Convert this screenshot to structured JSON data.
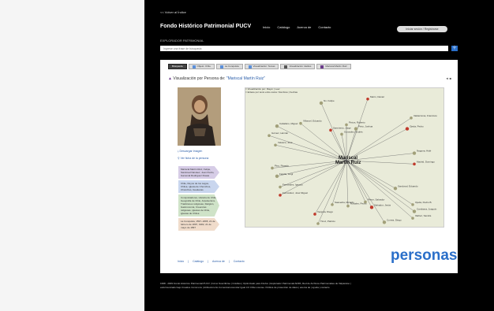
{
  "header": {
    "back_link": "<< Volver al Índice",
    "site_title": "Fondo Histórico Patrimonial PUCV",
    "nav": [
      "Inicio",
      "Catálogo",
      "Acerca de",
      "Contacto"
    ],
    "login_button": "Iniciar sesión / Registrarse"
  },
  "search": {
    "label": "EXPLORADOR PATRIMONIAL",
    "placeholder": "Ingrese una frase de búsqueda"
  },
  "tabs": [
    {
      "label": "Búsqueda",
      "active": true,
      "icon": "search-icon"
    },
    {
      "label": "Objeto: Chile",
      "active": false,
      "icon": "object-icon"
    },
    {
      "label": "La Conquista",
      "active": false,
      "icon": "object-icon"
    },
    {
      "label": "Visualización: Temas",
      "active": false,
      "icon": "graph-icon"
    },
    {
      "label": "Visualización: Estilos",
      "active": false,
      "icon": "graph-icon"
    },
    {
      "label": "Mariscal Martín Ruiz",
      "active": false,
      "icon": "person-icon"
    }
  ],
  "visualization": {
    "title_prefix": "Visualización por Persona de:",
    "title_name": "\"Mariscal Martín Ruiz\"",
    "controls": "◄ ■",
    "legend": [
      "= Visualización por: Mayor | Leer",
      "= Enlace por texto entre éstos: Nombres | Fechas"
    ]
  },
  "sidebar": {
    "download_link": "Descargar Imagen",
    "record_link": "Ver ficha de la persona",
    "boxes": [
      {
        "text": "Mariscal Martín Ruiz, Felipe, Sandoval Narváez, Juan Pedro, Gamonal Rodríguez Rosas",
        "color": "#d6cce6"
      },
      {
        "text": "Chile, Reyno de los Lagos, Chiloé, iglesia de Chonchos, Chonchos, Guaitecas",
        "color": "#c9d6ee"
      },
      {
        "text": "Conquistadores, Historia de Chile, Geografía de Chile, Arquitectura, Tradiciones religiosas, Religión, Gastronomía, Creencias religiosas, iglesias de Chile, iglesias de Chiloé",
        "color": "#cfe3c8"
      },
      {
        "text": "La Conquista, 1597–1895, 21 de febrero de 1897, 1982, 21 de mayo de 1897",
        "color": "#f0dccb"
      }
    ]
  },
  "chart_data": {
    "type": "network",
    "center": "Mariscal Martín Ruiz",
    "nodes": [
      "Nn. Felipe",
      "Marín, Daniel",
      "Villaruel, Eduardo",
      "Caballero, Miguel",
      "Pintos, Roberto",
      "Sarmiento, Jorge",
      "Pinto, Joshua",
      "Gonzalez, Andrés",
      "Valderrama, Francisco",
      "Ojeda, Pedro",
      "Gómez, Hernán",
      "Velasco, José",
      "Nagona, Hidé",
      "Madrid, Domingo",
      "Pino, Ricardo",
      "Farello, Luigi",
      "Fernández, Ignacio",
      "Fernández, José Miguel",
      "Sandoval, Eduardo",
      "Saavedra, Ricardo",
      "Pérez, Salvador",
      "Salvador, Jesús",
      "Rosales, Pedro",
      "Ojeda, Pedro B.",
      "Cambana, Joaquín",
      "Vergara, Diego",
      "Tinoz, Patricio",
      "Correa, Diego",
      "Ibáñez, Sandra"
    ]
  },
  "brand_word": "personas",
  "footer_links": [
    "Inicio",
    "Catálogo",
    "Acerca de",
    "Contacto"
  ],
  "footer": {
    "line1": "1998 - 2009 Fondo Histórico Patrimonial PUCV | Cómo Suscribirse | Créditos | Optimizado para Firefox | Explorador Patrimonial ARPA, Red de Archivos Patrimoniales de Valparaíso |",
    "line2": "está licenciado bajo Creative Commons | Atribución-No Comercial-Licenciar Igual 3.0 Chile License. Política de protección de datos | acerca de | ayuda | contacto"
  }
}
